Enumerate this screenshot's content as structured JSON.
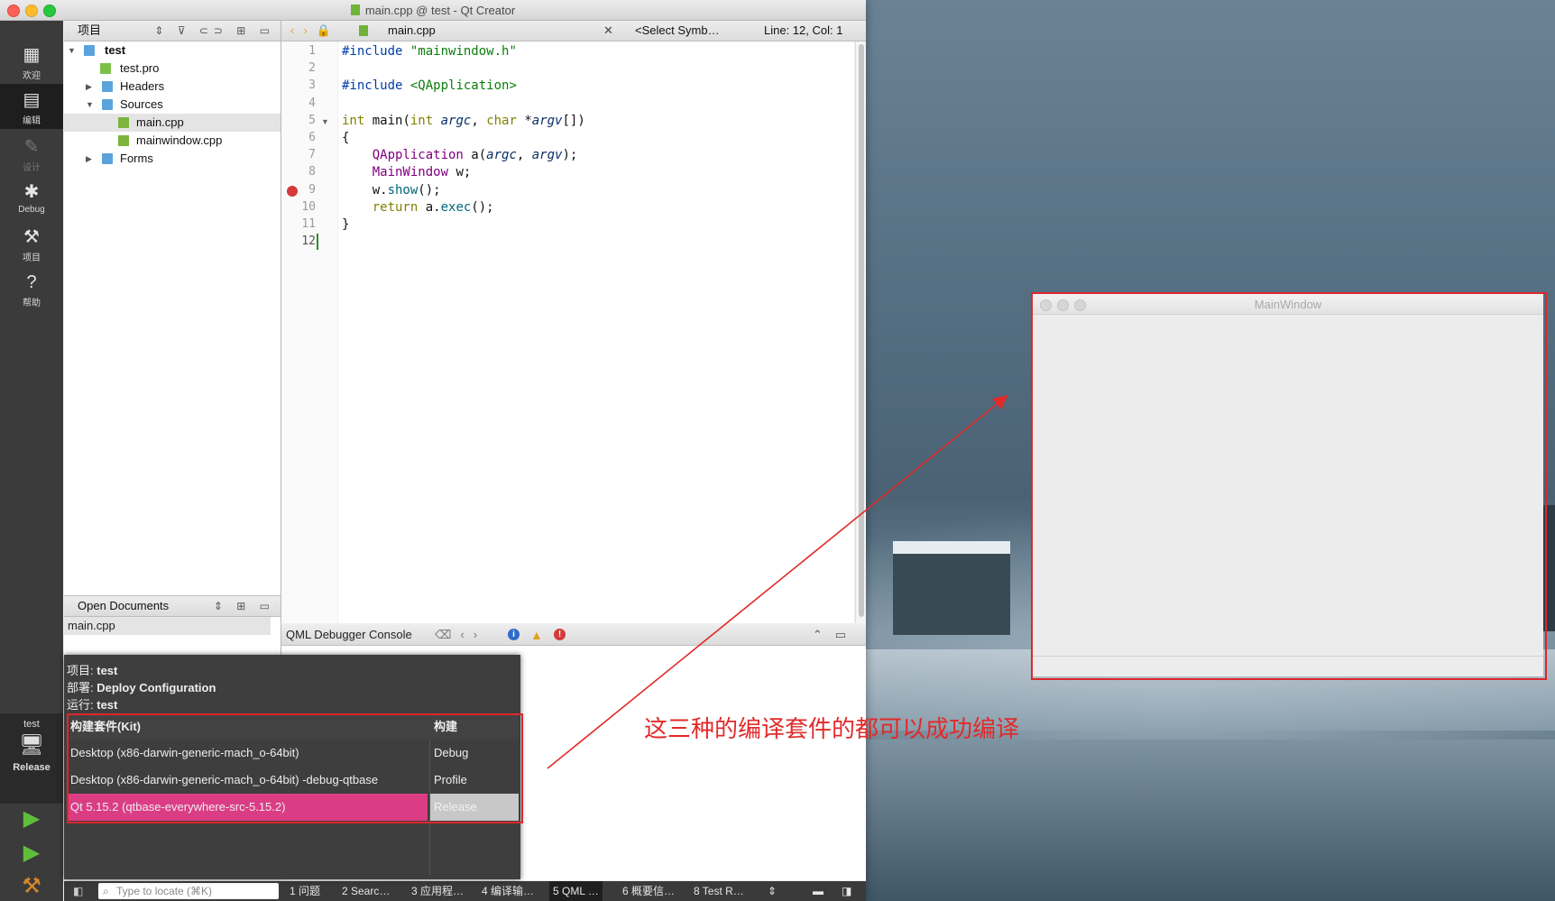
{
  "window": {
    "title": "main.cpp @ test - Qt Creator"
  },
  "modes": [
    {
      "label": "欢迎",
      "icon": "grid-icon"
    },
    {
      "label": "编辑",
      "icon": "edit-doc-icon"
    },
    {
      "label": "设计",
      "icon": "pencil-icon"
    },
    {
      "label": "Debug",
      "icon": "bug-icon"
    },
    {
      "label": "项目",
      "icon": "wrench-icon"
    },
    {
      "label": "帮助",
      "icon": "help-icon"
    }
  ],
  "kit_selector": {
    "project": "test",
    "mode": "Release"
  },
  "project_pane": {
    "title": "项目",
    "tree": [
      {
        "label": "test"
      },
      {
        "label": "test.pro"
      },
      {
        "label": "Headers"
      },
      {
        "label": "Sources"
      },
      {
        "label": "main.cpp"
      },
      {
        "label": "mainwindow.cpp"
      },
      {
        "label": "Forms"
      }
    ]
  },
  "open_docs": {
    "title": "Open Documents",
    "items": [
      "main.cpp"
    ]
  },
  "editor": {
    "file": "main.cpp",
    "symbol": "<Select Symb…",
    "position": "Line: 12, Col: 1",
    "line_numbers": [
      "1",
      "2",
      "3",
      "4",
      "5",
      "6",
      "7",
      "8",
      "9",
      "10",
      "11",
      "12"
    ]
  },
  "output": {
    "title": "QML Debugger Console"
  },
  "kit_popup": {
    "project_label": "项目:",
    "project": "test",
    "deploy_label": "部署:",
    "deploy": "Deploy Configuration",
    "run_label": "运行:",
    "run": "test",
    "header_kit": "构建套件(Kit)",
    "header_build": "构建",
    "rows": [
      {
        "kit": "Desktop (x86-darwin-generic-mach_o-64bit)",
        "build": "Debug"
      },
      {
        "kit": "Desktop (x86-darwin-generic-mach_o-64bit) -debug-qtbase",
        "build": "Profile"
      },
      {
        "kit": "Qt 5.15.2 (qtbase-everywhere-src-5.15.2)",
        "build": "Release"
      }
    ]
  },
  "statusbar": {
    "locator_placeholder": "Type to locate (⌘K)",
    "tabs": [
      "1 问题",
      "2 Searc…",
      "3 应用程…",
      "4 编译输…",
      "5 QML …",
      "6 概要信…",
      "8 Test R…"
    ]
  },
  "main_window": {
    "title": "MainWindow"
  },
  "annotation": "这三种的编译套件的都可以成功编译",
  "colors": {
    "highlight": "#db3d85",
    "annotation": "#e22a2a"
  }
}
